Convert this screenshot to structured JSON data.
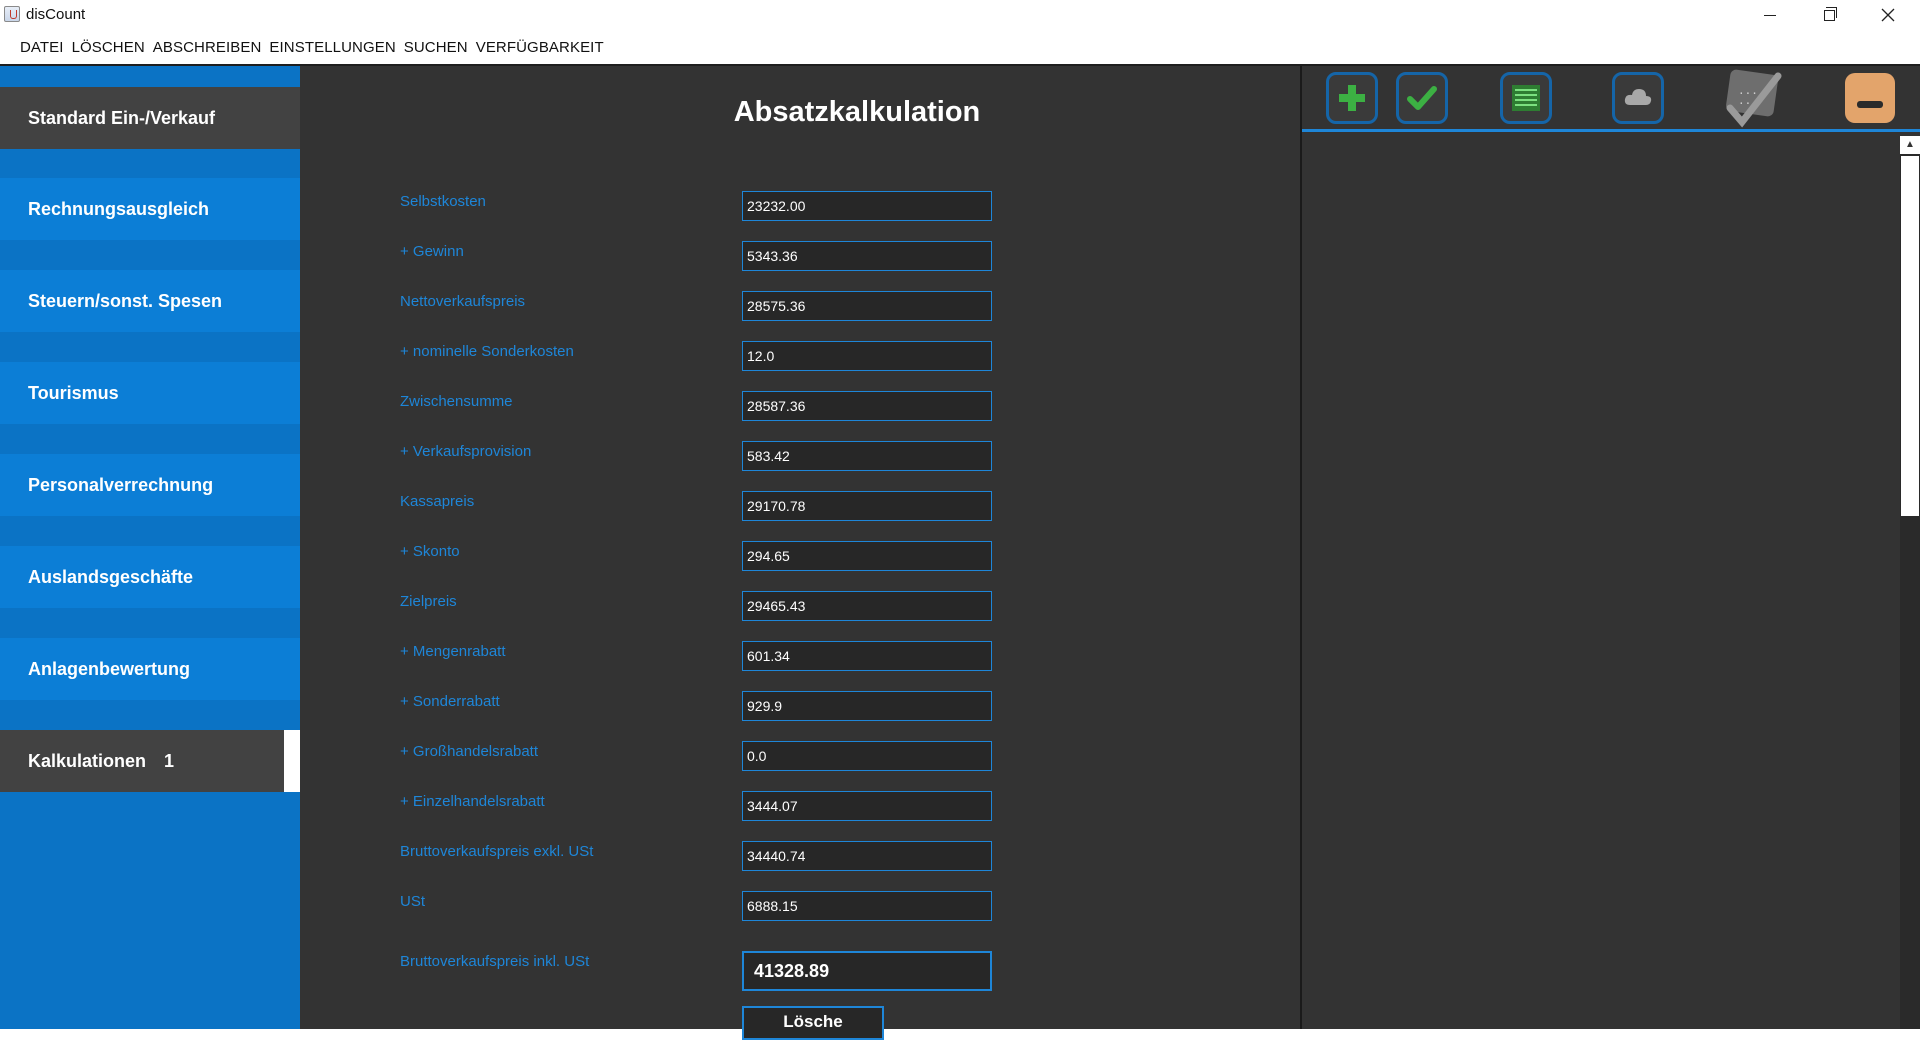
{
  "window": {
    "title": "disCount"
  },
  "menu": [
    "DATEI",
    "LÖSCHEN",
    "ABSCHREIBEN",
    "EINSTELLUNGEN",
    "SUCHEN",
    "VERFÜGBARKEIT"
  ],
  "sidebar": {
    "items": [
      {
        "label": "Standard Ein-/Verkauf",
        "active": true
      },
      {
        "label": "Rechnungsausgleich"
      },
      {
        "label": "Steuern/sonst. Spesen"
      },
      {
        "label": "Tourismus"
      },
      {
        "label": "Personalverrechnung"
      },
      {
        "label": "Auslandsgeschäfte"
      },
      {
        "label": "Anlagenbewertung"
      },
      {
        "label": "Kalkulationen",
        "count": "1",
        "active": true
      }
    ]
  },
  "main": {
    "title": "Absatzkalkulation",
    "rows": [
      {
        "label": "Selbstkosten",
        "value": "23232.00"
      },
      {
        "label": "+ Gewinn",
        "value": "5343.36"
      },
      {
        "label": "Nettoverkaufspreis",
        "value": "28575.36"
      },
      {
        "label": "+ nominelle Sonderkosten",
        "value": "12.0"
      },
      {
        "label": "Zwischensumme",
        "value": "28587.36"
      },
      {
        "label": "+ Verkaufsprovision",
        "value": "583.42"
      },
      {
        "label": "Kassapreis",
        "value": "29170.78"
      },
      {
        "label": "+ Skonto",
        "value": "294.65"
      },
      {
        "label": "Zielpreis",
        "value": "29465.43"
      },
      {
        "label": "+ Mengenrabatt",
        "value": "601.34"
      },
      {
        "label": "+ Sonderrabatt",
        "value": "929.9"
      },
      {
        "label": "+ Großhandelsrabatt",
        "value": "0.0"
      },
      {
        "label": "+ Einzelhandelsrabatt",
        "value": "3444.07"
      },
      {
        "label": "Bruttoverkaufspreis exkl. USt",
        "value": "34440.74"
      },
      {
        "label": "USt",
        "value": "6888.15"
      }
    ],
    "total": {
      "label": "Bruttoverkaufspreis inkl. USt",
      "value": "41328.89"
    },
    "clear_label": "Lösche"
  },
  "toolbar": {
    "buttons": [
      "add-icon",
      "check-icon",
      "list-icon",
      "cloud-icon",
      "calculator-icon",
      "minimize-icon"
    ]
  },
  "colors": {
    "accent": "#1e86d8",
    "sidebar": "#0c7ed6",
    "active_item": "#424242",
    "background": "#333333",
    "green": "#3cb043",
    "minimize": "#e3a46b"
  }
}
